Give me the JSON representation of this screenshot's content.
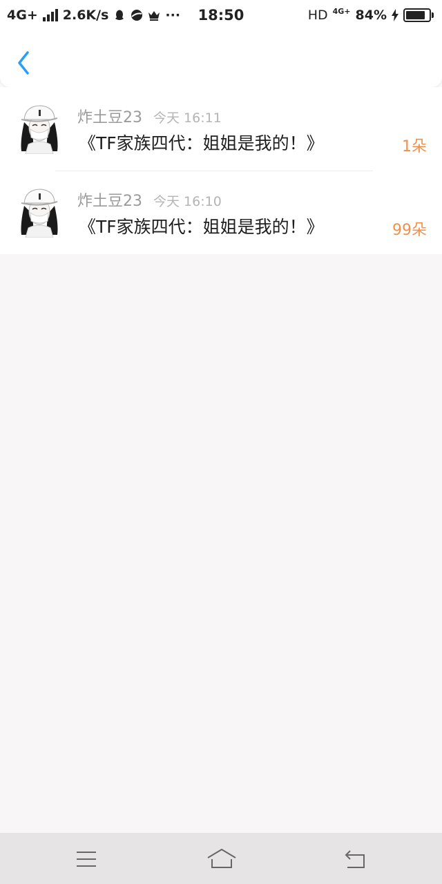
{
  "status_bar": {
    "network": "4G+",
    "speed": "2.6K/s",
    "more": "···",
    "time": "18:50",
    "hd": "HD",
    "network2": "4G+",
    "battery": "84%"
  },
  "header": {
    "back_icon": "chevron-left-icon",
    "accent_color": "#2a9df4"
  },
  "records": [
    {
      "username": "炸土豆23",
      "time": "今天 16:11",
      "title": "《TF家族四代：姐姐是我的！》",
      "count": "1朵"
    },
    {
      "username": "炸土豆23",
      "time": "今天 16:10",
      "title": "《TF家族四代：姐姐是我的！》",
      "count": "99朵"
    }
  ],
  "system_nav": {
    "menu_icon": "menu-icon",
    "home_icon": "home-icon",
    "back_icon": "return-icon"
  },
  "colors": {
    "count": "#f0904a",
    "background": "#f8f6f7"
  }
}
